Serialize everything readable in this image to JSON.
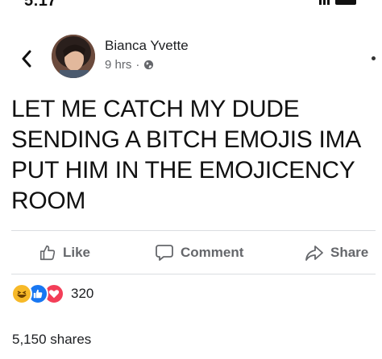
{
  "post": {
    "author": "Bianca Yvette",
    "time": "9 hrs",
    "privacy_icon": "globe-icon",
    "text": "LET ME CATCH MY DUDE\nSENDING A BITCH EMOJIS IMA\nPUT HIM IN THE EMOJICENCY\nROOM"
  },
  "actions": {
    "like": "Like",
    "comment": "Comment",
    "share": "Share"
  },
  "reactions": {
    "icons": [
      "haha-icon",
      "like-icon",
      "love-icon"
    ],
    "count": "320"
  },
  "shares": "5,150 shares",
  "colors": {
    "text": "#1c1e21",
    "secondary": "#65676b",
    "like_blue": "#1877f2",
    "love_red": "#f33e58",
    "haha_yellow": "#f7b928",
    "divider": "#dadde1"
  }
}
